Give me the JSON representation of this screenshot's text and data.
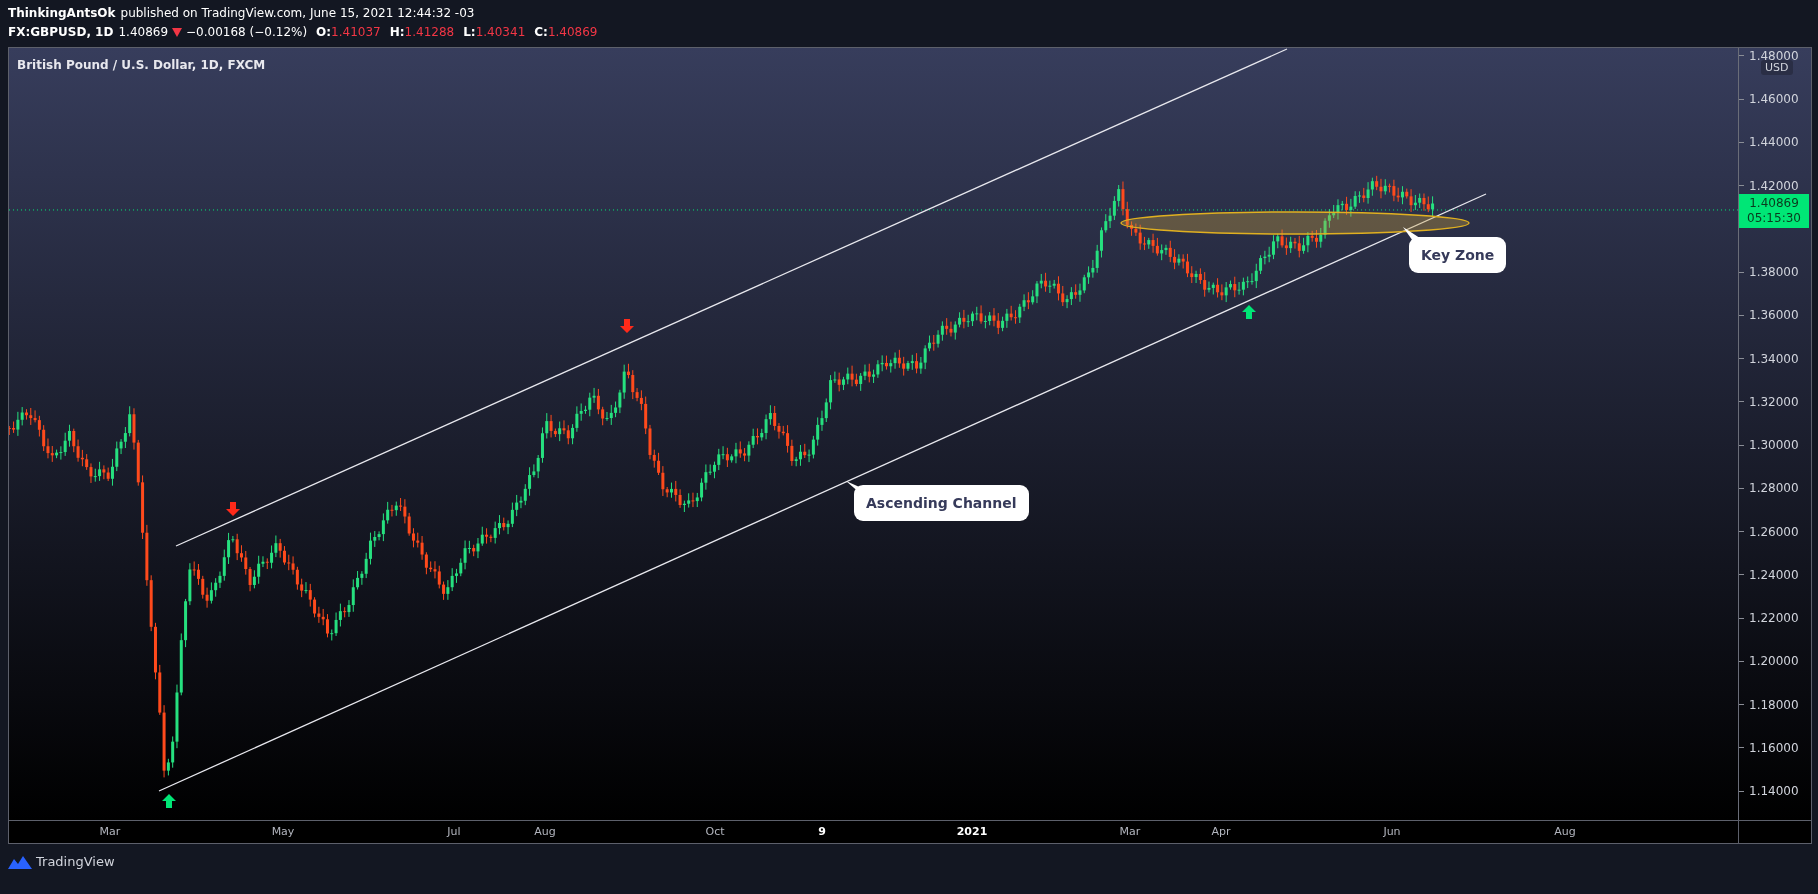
{
  "header": {
    "author": "ThinkingAntsOk",
    "published": "published on TradingView.com, June 15, 2021 12:44:32 -03"
  },
  "symbol_bar": {
    "symbol": "FX:GBPUSD, 1D",
    "last": "1.40869",
    "falling": true,
    "change": "−0.00168 (−0.12%)",
    "ohlc": [
      {
        "label": "O:",
        "value": "1.41037"
      },
      {
        "label": "H:",
        "value": "1.41288"
      },
      {
        "label": "L:",
        "value": "1.40341"
      },
      {
        "label": "C:",
        "value": "1.40869"
      }
    ]
  },
  "chart": {
    "title": "British Pound / U.S. Dollar, 1D, FXCM",
    "currency": "USD",
    "price_labels": [
      "1.48000",
      "1.46000",
      "1.44000",
      "1.42000",
      "1.38000",
      "1.36000",
      "1.34000",
      "1.32000",
      "1.30000",
      "1.28000",
      "1.26000",
      "1.24000",
      "1.22000",
      "1.20000",
      "1.18000",
      "1.16000",
      "1.14000"
    ],
    "time_labels": [
      {
        "label": "Mar",
        "bold": false
      },
      {
        "label": "May",
        "bold": false
      },
      {
        "label": "Jul",
        "bold": false
      },
      {
        "label": "Aug",
        "bold": false
      },
      {
        "label": "Oct",
        "bold": false
      },
      {
        "label": "9",
        "bold": true
      },
      {
        "label": "2021",
        "bold": true
      },
      {
        "label": "Mar",
        "bold": false
      },
      {
        "label": "Apr",
        "bold": false
      },
      {
        "label": "Jun",
        "bold": false
      },
      {
        "label": "Aug",
        "bold": false
      }
    ],
    "current_price": {
      "price": "1.40869",
      "countdown": "05:15:30"
    },
    "annotations": [
      {
        "text": "Ascending Channel"
      },
      {
        "text": "Key Zone"
      }
    ],
    "markers": [
      {
        "kind": "up"
      },
      {
        "kind": "down"
      },
      {
        "kind": "down"
      },
      {
        "kind": "up"
      }
    ]
  },
  "footer": {
    "brand": "TradingView"
  }
}
